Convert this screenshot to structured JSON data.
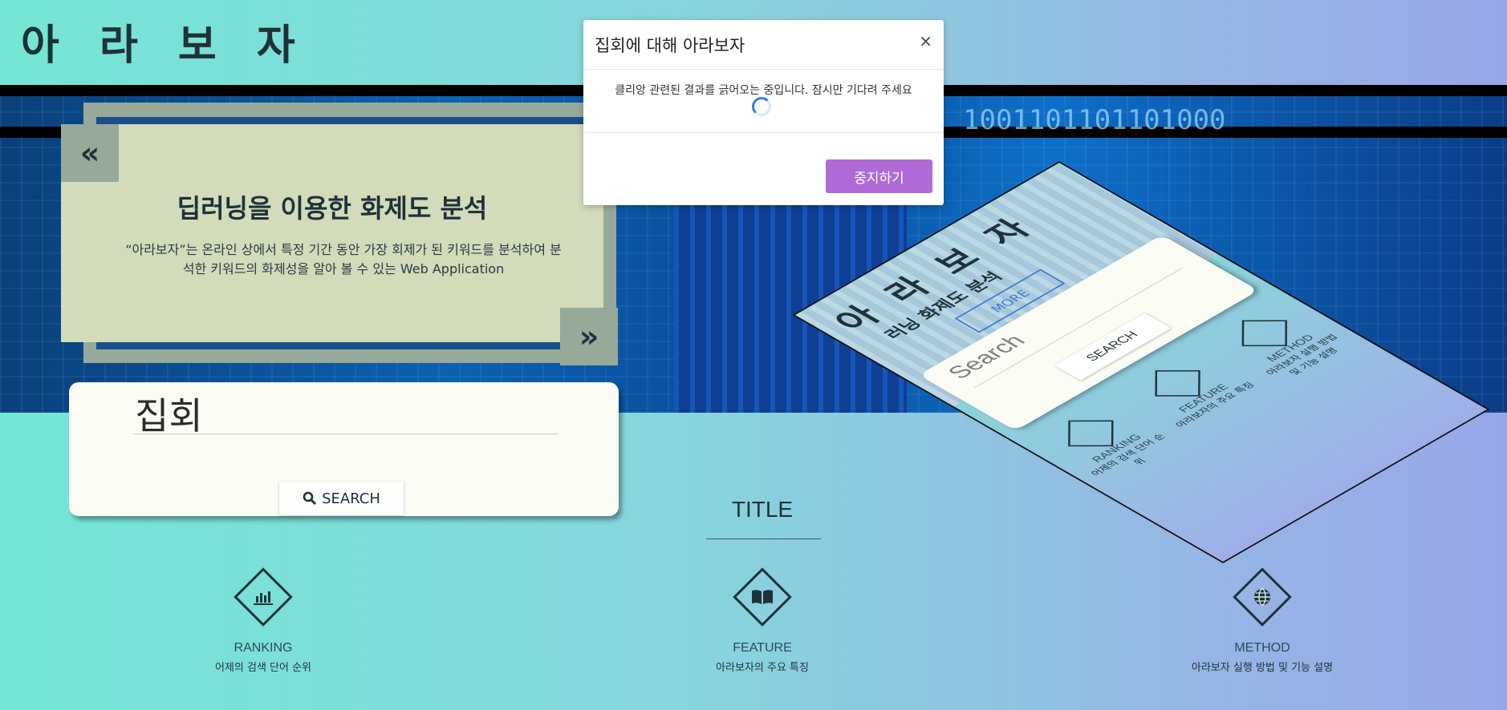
{
  "logo": "아 라 보 자",
  "slide": {
    "prev": "«",
    "next": "»",
    "title": "딥러닝을 이용한 화제도 분석",
    "description": "“아라보자”는 온라인 상에서 특정 기간 동안 가장 회제가 된 키워드를 분석하여 분석한 키워드의 화제성을 알아 볼 수 있는 Web Application"
  },
  "hero": {
    "binary": "1001101101101000"
  },
  "search": {
    "value": "집회",
    "button": "SEARCH"
  },
  "section": {
    "title": "TITLE"
  },
  "features": [
    {
      "icon": "chart-icon",
      "title": "RANKING",
      "desc": "어제의 검색 단어 순위"
    },
    {
      "icon": "book-icon",
      "title": "FEATURE",
      "desc": "아라보자의 주요 특징"
    },
    {
      "icon": "globe-icon",
      "title": "METHOD",
      "desc": "아라보자 실행 방법 및 기능 설명"
    }
  ],
  "preview": {
    "logo": "아 라 보 자",
    "subtitle": "러닝 화제도 분석",
    "more": "MORE",
    "search_placeholder": "Search",
    "search_button": "SEARCH",
    "features": [
      {
        "title": "RANKING",
        "desc": "어제의 검색 단어 순위"
      },
      {
        "title": "FEATURE",
        "desc": "아라보자의 주요 특징"
      },
      {
        "title": "METHOD",
        "desc": "아라보자 실행 방법 및 기능 설명"
      }
    ]
  },
  "modal": {
    "title": "집회에 대해 아라보자",
    "close": "×",
    "message": "클리앙 관련된 결과를 긁어오는 중입니다. 잠시만 기다려 주세요",
    "stop_button": "중지하기"
  },
  "colors": {
    "accent": "#b06ad8",
    "dark": "#1f3238",
    "slide_bg": "#d2dbba"
  }
}
